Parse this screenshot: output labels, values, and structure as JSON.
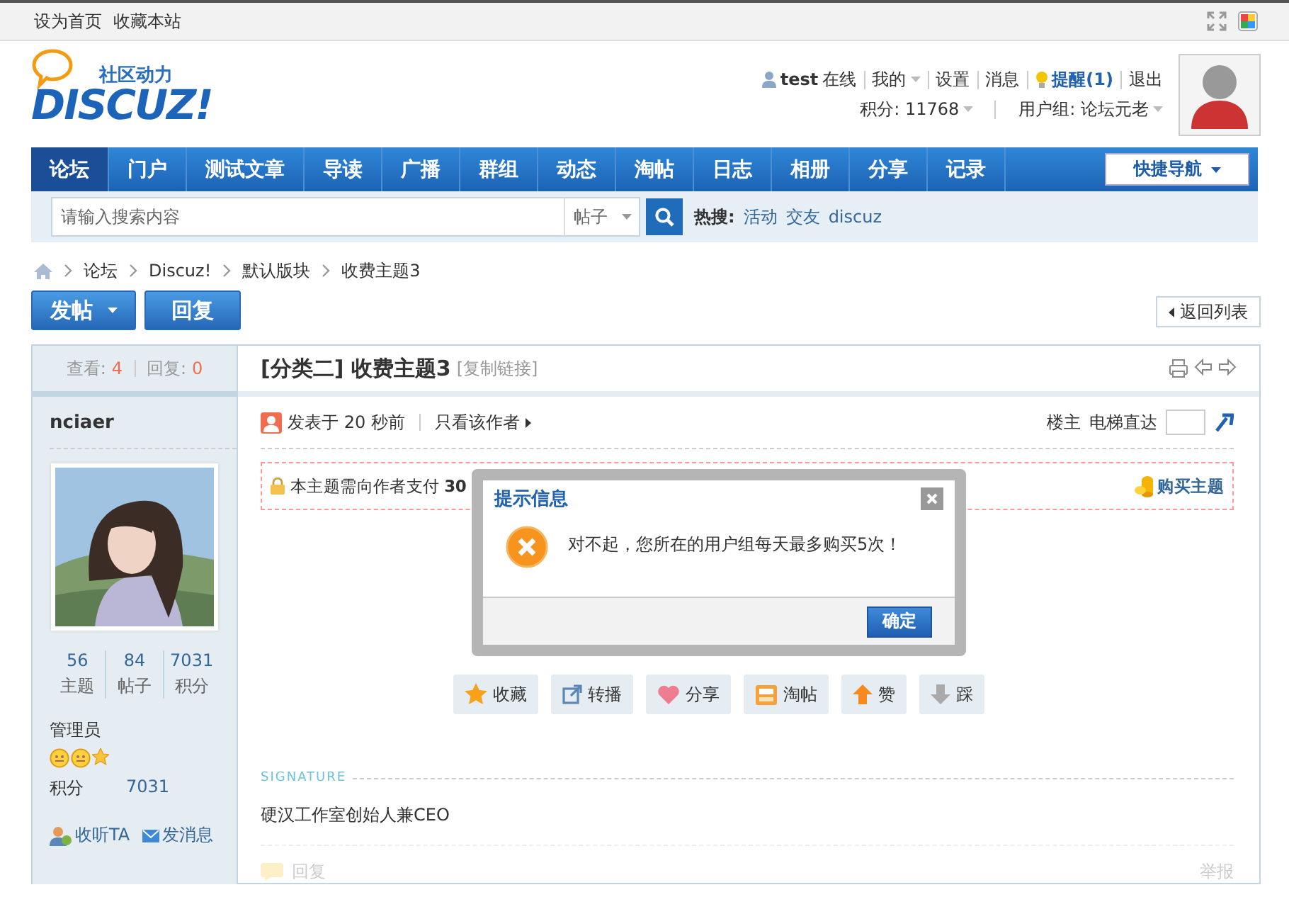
{
  "topbar": {
    "links": [
      "设为首页",
      "收藏本站"
    ]
  },
  "header": {
    "tagline": "社区动力",
    "logo": "DISCUZ!",
    "username": "test",
    "status": "在线",
    "links": [
      {
        "label": "我的",
        "kind": "dropdown"
      },
      {
        "label": "设置",
        "kind": "link"
      },
      {
        "label": "消息",
        "kind": "link"
      },
      {
        "label": "提醒(1)",
        "kind": "alert"
      },
      {
        "label": "退出",
        "kind": "link"
      }
    ],
    "points": "积分: 11768",
    "group": "用户组: 论坛元老"
  },
  "nav": {
    "items": [
      {
        "label": "论坛",
        "selected": true
      },
      {
        "label": "门户",
        "selected": false
      },
      {
        "label": "测试文章",
        "selected": false
      },
      {
        "label": "导读",
        "selected": false
      },
      {
        "label": "广播",
        "selected": false
      },
      {
        "label": "群组",
        "selected": false
      },
      {
        "label": "动态",
        "selected": false
      },
      {
        "label": "淘帖",
        "selected": false
      },
      {
        "label": "日志",
        "selected": false
      },
      {
        "label": "相册",
        "selected": false
      },
      {
        "label": "分享",
        "selected": false
      },
      {
        "label": "记录",
        "selected": false
      }
    ],
    "quick_nav": "快捷导航"
  },
  "search": {
    "placeholder": "请输入搜索内容",
    "type": "帖子",
    "hot_label": "热搜:",
    "hot": [
      "活动",
      "交友",
      "discuz"
    ]
  },
  "breadcrumb": [
    "论坛",
    "Discuz!",
    "默认版块",
    "收费主题3"
  ],
  "toolbar": {
    "post": "发帖",
    "reply": "回复",
    "back": "返回列表"
  },
  "thread": {
    "views_label": "查看:",
    "views": "4",
    "replies_label": "回复:",
    "replies": "0",
    "title": "[分类二] 收费主题3",
    "copy_link": "[复制链接]"
  },
  "author": {
    "name": "nciaer",
    "stats": [
      {
        "value": "56",
        "label": "主题"
      },
      {
        "value": "84",
        "label": "帖子"
      },
      {
        "value": "7031",
        "label": "积分"
      }
    ],
    "group": "管理员",
    "points_label": "积分",
    "points": "7031",
    "follow": "收听TA",
    "message": "发消息"
  },
  "post": {
    "posted": "发表于 20 秒前",
    "only_author": "只看该作者",
    "floor": "楼主",
    "jump": "电梯直达",
    "notice": "本主题需向作者支付 **30**",
    "buy": "购买主题",
    "buttons": [
      {
        "label": "收藏",
        "kind": "star"
      },
      {
        "label": "转播",
        "kind": "forward"
      },
      {
        "label": "分享",
        "kind": "heart"
      },
      {
        "label": "淘帖",
        "kind": "tray"
      },
      {
        "label": "赞",
        "kind": "up"
      },
      {
        "label": "踩",
        "kind": "down"
      }
    ],
    "signature_label": "SIGNATURE",
    "signature": "硬汉工作室创始人兼CEO",
    "reply": "回复",
    "report": "举报"
  },
  "dialog": {
    "title": "提示信息",
    "message": "对不起，您所在的用户组每天最多购买5次！",
    "ok": "确定"
  }
}
